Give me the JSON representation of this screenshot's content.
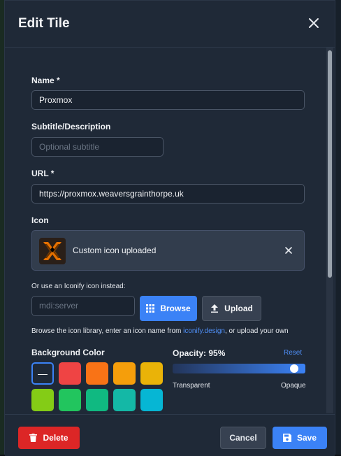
{
  "modal": {
    "title": "Edit Tile",
    "close_icon": "close-icon"
  },
  "form": {
    "name": {
      "label": "Name *",
      "value": "Proxmox"
    },
    "subtitle": {
      "label": "Subtitle/Description",
      "placeholder": "Optional subtitle",
      "value": ""
    },
    "url": {
      "label": "URL *",
      "value": "https://proxmox.weaversgrainthorpe.uk"
    },
    "icon": {
      "label": "Icon",
      "status": "Custom icon uploaded",
      "logo_icon": "proxmox-logo-icon",
      "remove_icon": "close-icon"
    },
    "iconify": {
      "label": "Or use an Iconify icon instead:",
      "placeholder": "mdi:server",
      "browse_label": "Browse",
      "browse_icon": "grid-icon",
      "upload_label": "Upload",
      "upload_icon": "upload-icon",
      "help_prefix": "Browse the icon library, enter an icon name from ",
      "help_link": "iconify.design",
      "help_suffix": ", or upload your own"
    },
    "background": {
      "label": "Background Color",
      "none_symbol": "—",
      "swatches": [
        "#1f2937",
        "#ef4444",
        "#f97316",
        "#f59e0b",
        "#eab308",
        "#84cc16",
        "#22c55e",
        "#10b981",
        "#14b8a6",
        "#06b6d4"
      ],
      "selected_index": 0
    },
    "opacity": {
      "label": "Opacity: 95%",
      "reset_label": "Reset",
      "value_percent": 95,
      "min_label": "Transparent",
      "max_label": "Opaque"
    }
  },
  "footer": {
    "delete_label": "Delete",
    "delete_icon": "trash-icon",
    "cancel_label": "Cancel",
    "save_label": "Save",
    "save_icon": "save-icon"
  },
  "colors": {
    "accent": "#3b82f6",
    "danger": "#dc2626",
    "panel": "#1f2937"
  }
}
